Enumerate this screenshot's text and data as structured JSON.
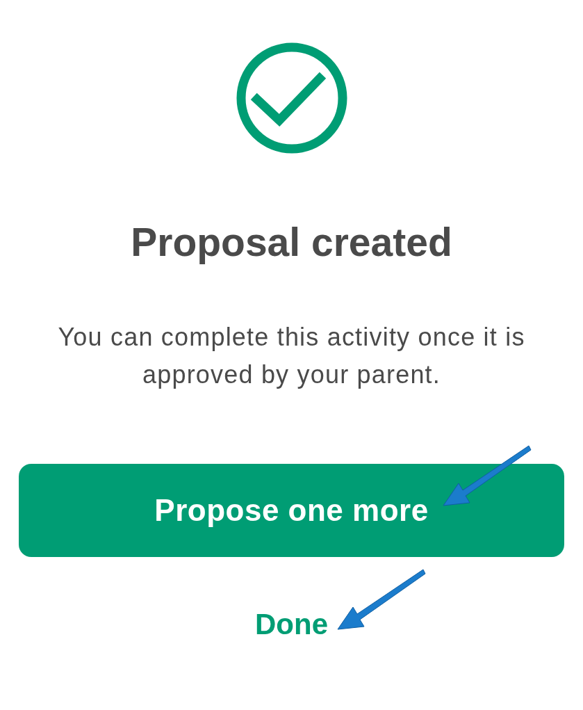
{
  "title": "Proposal created",
  "message": "You can complete this activity once it is approved by your parent.",
  "primary_button": {
    "label": "Propose one more"
  },
  "secondary_link": {
    "label": "Done"
  }
}
